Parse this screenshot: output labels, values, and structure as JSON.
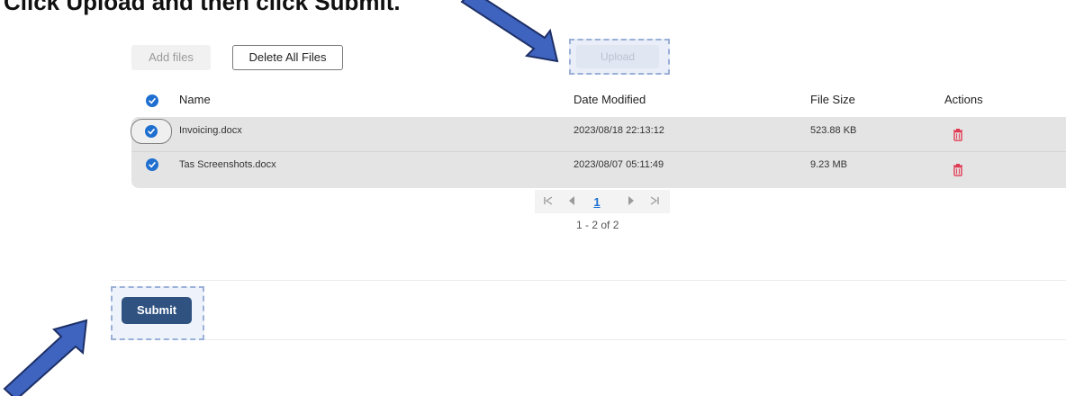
{
  "heading_fragment": "Click Upload and then click Submit.",
  "toolbar": {
    "add_files": "Add files",
    "delete_all": "Delete All Files",
    "upload": "Upload"
  },
  "table": {
    "columns": [
      "Name",
      "Date Modified",
      "File Size",
      "Actions"
    ],
    "rows": [
      {
        "name": "Invoicing.docx",
        "date": "2023/08/18 22:13:12",
        "size": "523.88 KB",
        "checked": true
      },
      {
        "name": "Tas Screenshots.docx",
        "date": "2023/08/07 05:11:49",
        "size": "9.23 MB",
        "checked": true
      }
    ]
  },
  "pagination": {
    "current_page": "1",
    "range_text": "1 - 2 of 2"
  },
  "submit": {
    "label": "Submit"
  },
  "colors": {
    "accent": "#1e6fd0",
    "submit": "#2f5281",
    "delete_icon": "#e03a52",
    "arrow": "#3e64c0",
    "highlight_border": "#9bb0d8"
  },
  "icons": {
    "check": "check-circle-icon",
    "delete": "trash-icon",
    "first": "page-first-icon",
    "prev": "page-prev-icon",
    "next": "page-next-icon",
    "last": "page-last-icon",
    "pointer": "annotation-arrow-icon"
  }
}
